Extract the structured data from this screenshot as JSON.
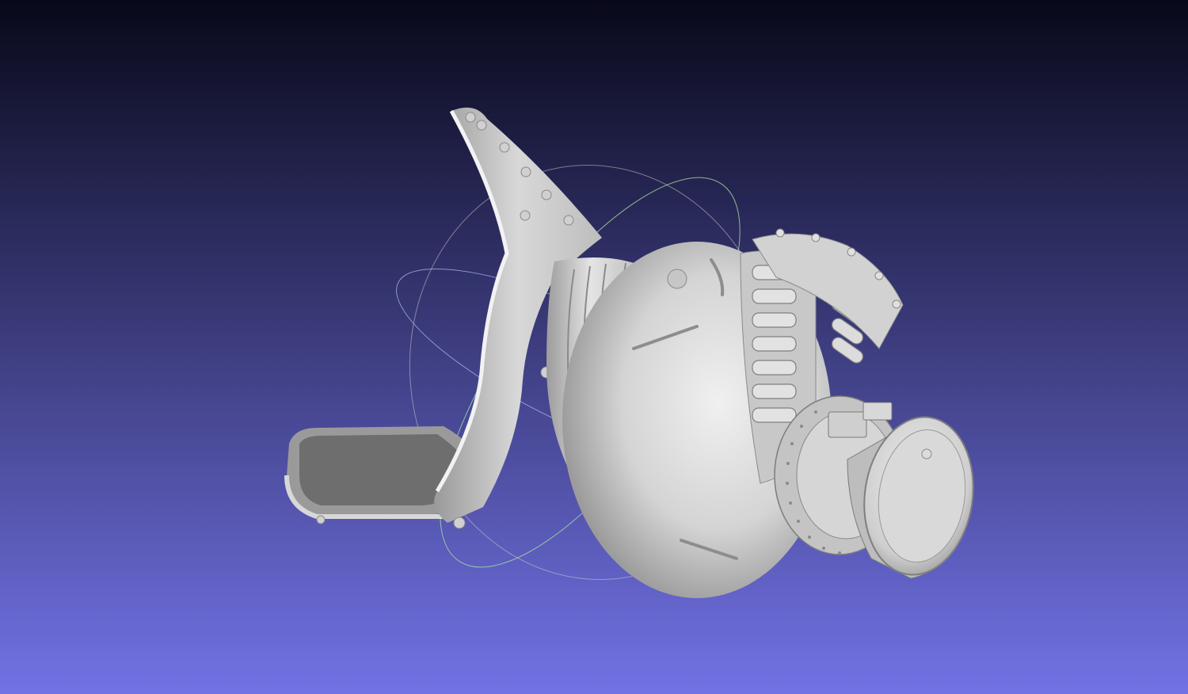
{
  "viewport": {
    "background_top": "#08081a",
    "background_bottom": "#7272e6",
    "model_color": "#d4d4d4",
    "model_shadow": "#8c8c8c",
    "trackball": {
      "x_ring_color": "#c8c8c8",
      "y_ring_color": "#a8e0a0",
      "z_ring_color": "#b8c0f0"
    }
  }
}
